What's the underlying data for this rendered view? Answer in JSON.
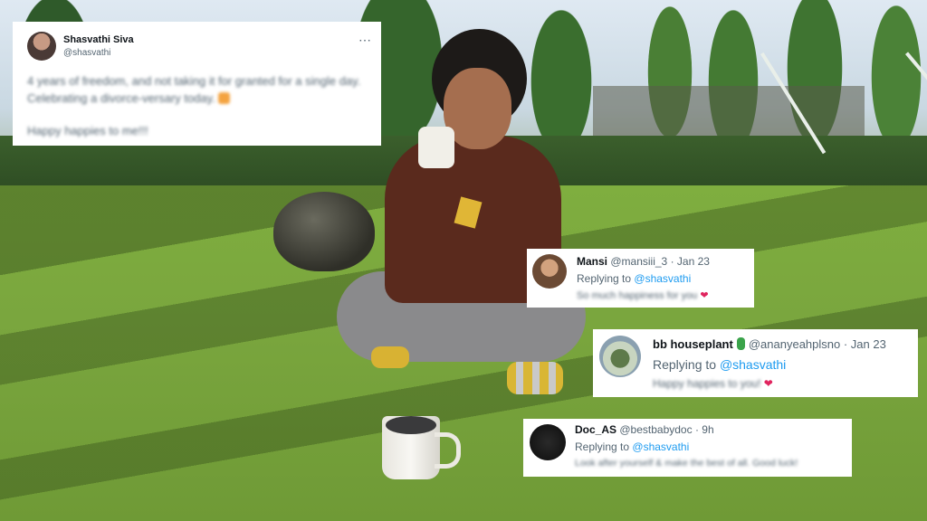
{
  "main_tweet": {
    "display_name": "Shasvathi Siva",
    "handle": "@shasvathi",
    "more_icon": "⋯",
    "text_line": "4 years of freedom, and not taking it for granted for a single day. Celebrating a divorce-versary today.",
    "text_line2": "Happy happies to me!!!"
  },
  "replies": [
    {
      "display_name": "Mansi",
      "handle": "@mansiii_3",
      "date": "· Jan 23",
      "replying_label": "Replying to",
      "replying_to": "@shasvathi",
      "text": "So much happiness for you",
      "heart": "❤"
    },
    {
      "display_name": "bb houseplant",
      "handle": "@ananyeahplsno",
      "date": "· Jan 23",
      "replying_label": "Replying to",
      "replying_to": "@shasvathi",
      "text": "Happy happies to you!",
      "heart": "❤"
    },
    {
      "display_name": "Doc_AS",
      "handle": "@bestbabydoc",
      "date": "· 9h",
      "replying_label": "Replying to",
      "replying_to": "@shasvathi",
      "text": "Look after yourself & make the best of all. Good luck!"
    }
  ]
}
